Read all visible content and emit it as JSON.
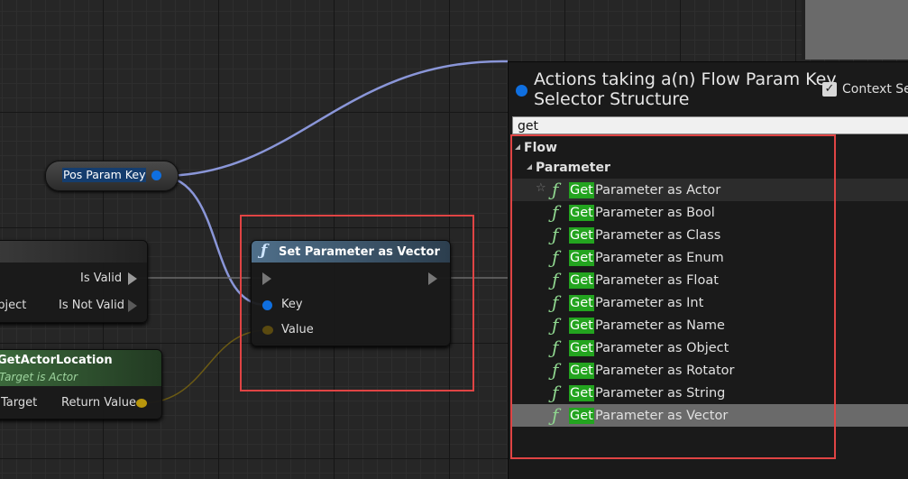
{
  "graph": {
    "var_node_label": "Pos Param Key",
    "set_node": {
      "title": "Set Parameter as Vector",
      "key_label": "Key",
      "value_label": "Value"
    },
    "valid_node": {
      "is_valid": "Is Valid",
      "object_label": "Object",
      "is_not_valid": "Is Not Valid"
    },
    "location_node": {
      "title": "GetActorLocation",
      "subtitle": "Target is Actor",
      "target_label": "Target",
      "return_label": "Return Value"
    }
  },
  "menu": {
    "title_line1": "Actions taking a(n) Flow Param Key",
    "title_line2": "Selector Structure",
    "context_label": "Context Se",
    "search_value": "get",
    "category": "Flow",
    "subcategory": "Parameter",
    "highlight": "Get",
    "items": [
      "Parameter as Actor",
      "Parameter as Bool",
      "Parameter as Class",
      "Parameter as Enum",
      "Parameter as Float",
      "Parameter as Int",
      "Parameter as Name",
      "Parameter as Object",
      "Parameter as Rotator",
      "Parameter as String",
      "Parameter as Vector"
    ]
  },
  "colors": {
    "struct_pin": "#0f6fe0",
    "vector_pin": "#b8960c",
    "highlight_bg": "#23a41f",
    "annotation": "#e04444",
    "pure_header": "#2e5a2e"
  }
}
